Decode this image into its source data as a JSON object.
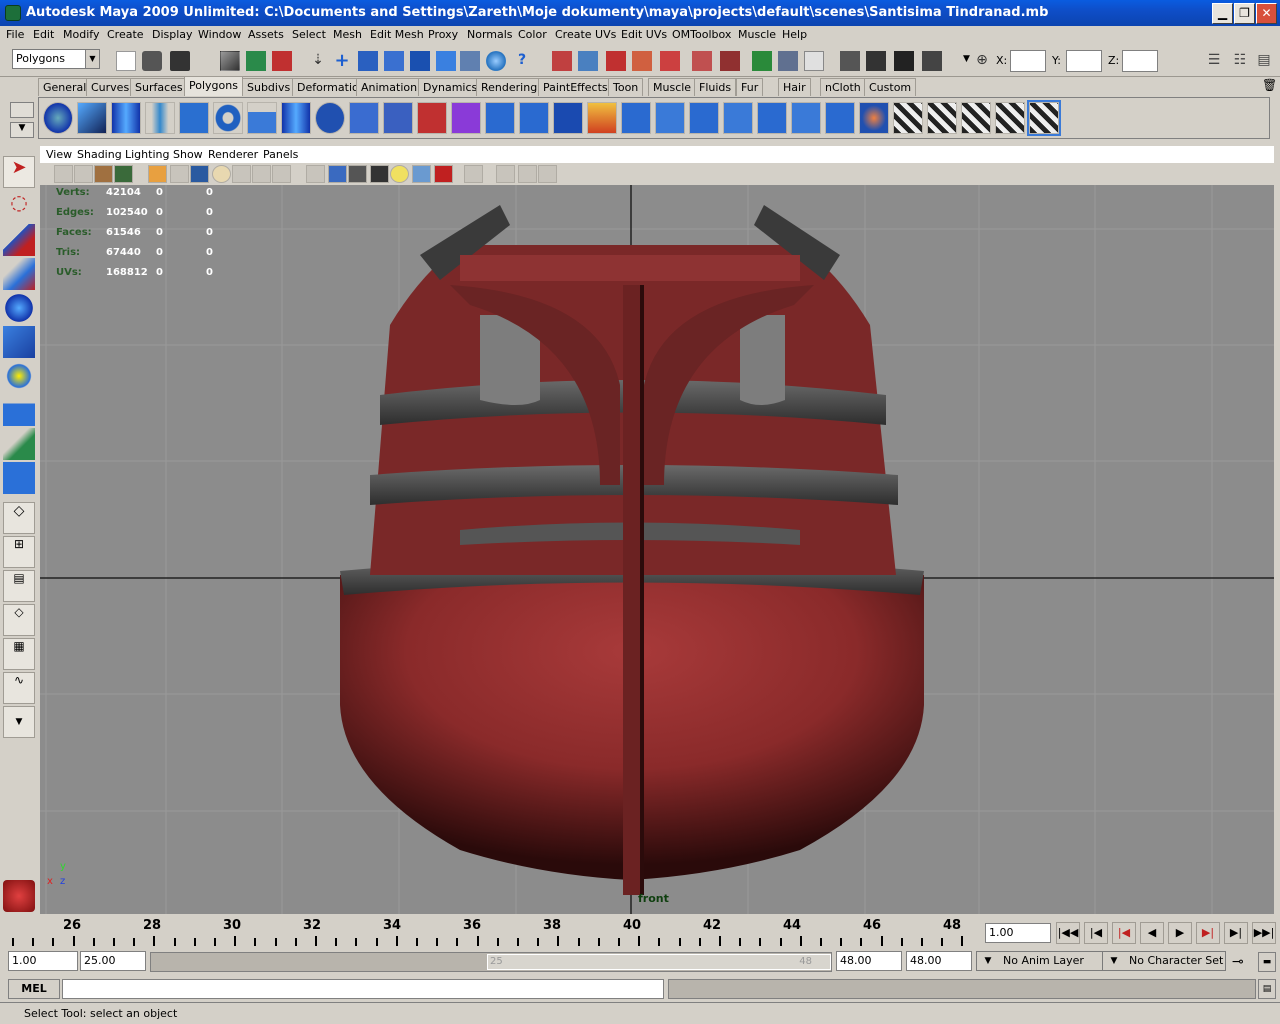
{
  "window": {
    "title": "Autodesk Maya 2009 Unlimited: C:\\Documents and Settings\\Zareth\\Moje dokumenty\\maya\\projects\\default\\scenes\\Santisima Tindranad.mb",
    "minimize": "▁",
    "restore": "❐",
    "close": "✕"
  },
  "menubar": [
    "File",
    "Edit",
    "Modify",
    "Create",
    "Display",
    "Window",
    "Assets",
    "Select",
    "Mesh",
    "Edit Mesh",
    "Proxy",
    "Normals",
    "Color",
    "Create UVs",
    "Edit UVs",
    "OMToolbox",
    "Muscle",
    "Help"
  ],
  "statusline": {
    "menuset": "Polygons",
    "x_label": "X:",
    "y_label": "Y:",
    "z_label": "Z:"
  },
  "shelf_tabs": [
    "General",
    "Curves",
    "Surfaces",
    "Polygons",
    "Subdivs",
    "Deformation",
    "Animation",
    "Dynamics",
    "Rendering",
    "PaintEffects",
    "Toon",
    "Muscle",
    "Fluids",
    "Fur",
    "Hair",
    "nCloth",
    "Custom"
  ],
  "shelf_active": "Polygons",
  "panel_menu": [
    "View",
    "Shading",
    "Lighting",
    "Show",
    "Renderer",
    "Panels"
  ],
  "hud": {
    "rows": [
      {
        "label": "Verts:",
        "total": "42104",
        "a": "0",
        "b": "0"
      },
      {
        "label": "Edges:",
        "total": "102540",
        "a": "0",
        "b": "0"
      },
      {
        "label": "Faces:",
        "total": "61546",
        "a": "0",
        "b": "0"
      },
      {
        "label": "Tris:",
        "total": "67440",
        "a": "0",
        "b": "0"
      },
      {
        "label": "UVs:",
        "total": "168812",
        "a": "0",
        "b": "0"
      }
    ],
    "camera": "front",
    "axis_y": "y",
    "axis_x": "x",
    "axis_z": "z"
  },
  "timeslider": {
    "labels": [
      "26",
      "28",
      "30",
      "32",
      "34",
      "36",
      "38",
      "40",
      "42",
      "44",
      "46",
      "48"
    ],
    "current_time": "1.00"
  },
  "range": {
    "start": "1.00",
    "playback_start": "25.00",
    "slider_min": "25",
    "slider_max": "48",
    "playback_end": "48.00",
    "end": "48.00",
    "anim_layer": "No Anim Layer",
    "char_set": "No Character Set"
  },
  "cmdline": {
    "label": "MEL"
  },
  "helpline": {
    "text": "Select Tool: select an object"
  },
  "colors": {
    "hull": "#8a2a2a",
    "viewport": "#8c8c8c",
    "titlebar": "#0a5ce0"
  }
}
